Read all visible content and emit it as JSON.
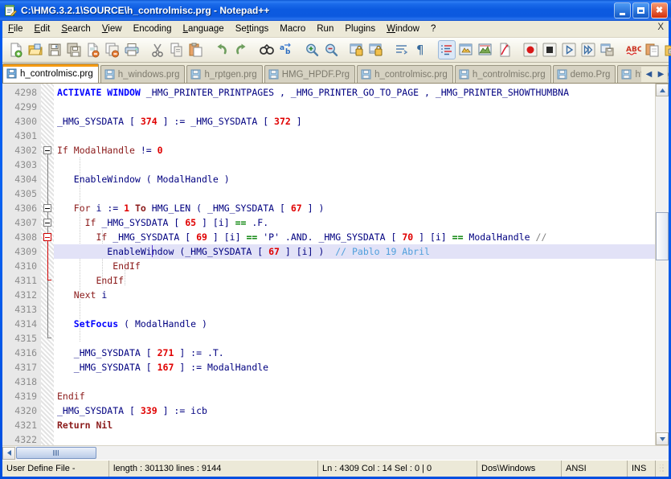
{
  "window": {
    "title": "C:\\HMG.3.2.1\\SOURCE\\h_controlmisc.prg - Notepad++",
    "icon": "notepad-document-icon",
    "buttons": {
      "minimize": "_",
      "maximize": "□",
      "close": "✕"
    }
  },
  "menubar": {
    "items": [
      {
        "label": "File",
        "mnemonic": "F"
      },
      {
        "label": "Edit",
        "mnemonic": "E"
      },
      {
        "label": "Search",
        "mnemonic": "S"
      },
      {
        "label": "View",
        "mnemonic": "V"
      },
      {
        "label": "Encoding",
        "mnemonic": ""
      },
      {
        "label": "Language",
        "mnemonic": "L"
      },
      {
        "label": "Settings",
        "mnemonic": "t"
      },
      {
        "label": "Macro",
        "mnemonic": ""
      },
      {
        "label": "Run",
        "mnemonic": ""
      },
      {
        "label": "Plugins",
        "mnemonic": ""
      },
      {
        "label": "Window",
        "mnemonic": "W"
      },
      {
        "label": "?",
        "mnemonic": ""
      }
    ],
    "close_document": "X"
  },
  "toolbar": {
    "buttons": [
      "new-file-icon",
      "open-file-icon",
      "save-icon",
      "save-all-icon",
      "close-file-icon",
      "close-all-icon",
      "print-icon",
      "cut-icon",
      "copy-icon",
      "paste-icon",
      "undo-icon",
      "redo-icon",
      "find-icon",
      "replace-icon",
      "zoom-in-icon",
      "zoom-out-icon",
      "sync-vertical-scroll-icon",
      "sync-horizontal-scroll-icon",
      "word-wrap-icon",
      "show-all-characters-icon",
      "show-indent-guide-icon",
      "user-defined-dialog-icon",
      "show-document-map-icon",
      "function-list-icon",
      "macro-record-icon",
      "macro-stop-icon",
      "macro-play-icon",
      "macro-play-multiple-icon",
      "macro-save-icon",
      "spell-check-icon",
      "copy-styled-text-icon",
      "folder-as-workspace-icon"
    ],
    "selected": "show-indent-guide-icon"
  },
  "tabs": [
    {
      "label": "h_controlmisc.prg",
      "active": true,
      "icon": "saved-file-icon"
    },
    {
      "label": "h_windows.prg",
      "active": false,
      "icon": "saved-file-icon"
    },
    {
      "label": "h_rptgen.prg",
      "active": false,
      "icon": "saved-file-icon"
    },
    {
      "label": "HMG_HPDF.Prg",
      "active": false,
      "icon": "saved-file-icon"
    },
    {
      "label": "h_controlmisc.prg",
      "active": false,
      "icon": "saved-file-icon"
    },
    {
      "label": "h_controlmisc.prg",
      "active": false,
      "icon": "saved-file-icon"
    },
    {
      "label": "demo.Prg",
      "active": false,
      "icon": "saved-file-icon"
    },
    {
      "label": "hfcl_hmg_",
      "active": false,
      "icon": "saved-file-icon"
    }
  ],
  "tab_scroll": {
    "left": "◀",
    "right": "▶"
  },
  "editor": {
    "first_line_number": 4298,
    "caret_line": 4309,
    "lines": [
      {
        "n": 4298,
        "text": "ACTIVATE WINDOW _HMG_PRINTER_PRINTPAGES , _HMG_PRINTER_GO_TO_PAGE , _HMG_PRINTER_SHOWTHUMBNA"
      },
      {
        "n": 4299,
        "text": ""
      },
      {
        "n": 4300,
        "text": "   _HMG_SYSDATA [ 374 ] := _HMG_SYSDATA [ 372 ]"
      },
      {
        "n": 4301,
        "text": ""
      },
      {
        "n": 4302,
        "text": "If ModalHandle != 0"
      },
      {
        "n": 4303,
        "text": ""
      },
      {
        "n": 4304,
        "text": "      EnableWindow ( ModalHandle )"
      },
      {
        "n": 4305,
        "text": ""
      },
      {
        "n": 4306,
        "text": "      For i := 1 To HMG_LEN ( _HMG_SYSDATA [ 67 ] )"
      },
      {
        "n": 4307,
        "text": "         If _HMG_SYSDATA [ 65 ] [i] == .F."
      },
      {
        "n": 4308,
        "text": "            If _HMG_SYSDATA [ 69 ] [i] == 'P' .AND. _HMG_SYSDATA [ 70 ] [i] == ModalHandle //"
      },
      {
        "n": 4309,
        "text": "               EnableWindow (_HMG_SYSDATA [ 67 ] [i] )  // Pablo 19 Abril"
      },
      {
        "n": 4310,
        "text": "            EndIf"
      },
      {
        "n": 4311,
        "text": "         EndIf"
      },
      {
        "n": 4312,
        "text": "      Next i"
      },
      {
        "n": 4313,
        "text": ""
      },
      {
        "n": 4314,
        "text": "      SetFocus ( ModalHandle )"
      },
      {
        "n": 4315,
        "text": ""
      },
      {
        "n": 4316,
        "text": "      _HMG_SYSDATA [ 271 ] := .T."
      },
      {
        "n": 4317,
        "text": "      _HMG_SYSDATA [ 167 ] := ModalHandle"
      },
      {
        "n": 4318,
        "text": ""
      },
      {
        "n": 4319,
        "text": "Endif"
      },
      {
        "n": 4320,
        "text": "_HMG_SYSDATA [ 339 ] := icb"
      },
      {
        "n": 4321,
        "text": "Return Nil"
      },
      {
        "n": 4322,
        "text": ""
      }
    ]
  },
  "statusbar": {
    "doc_type": "User Define File -",
    "length_lines": "length : 301130    lines : 9144",
    "position": "Ln : 4309    Col : 14    Sel : 0 | 0",
    "eol": "Dos\\Windows",
    "encoding": "ANSI",
    "insert_mode": "INS"
  },
  "colors": {
    "titlebar_blue": "#0a5ae0",
    "keyword_blue": "#0000ff",
    "identifier_maroon": "#8b1a1a",
    "number_red": "#e00000",
    "operator_navy": "#000080",
    "comment_gray": "#808080",
    "comment_blue": "#4f9fdc",
    "highlight_line": "#e2e2f7",
    "active_tab_accent": "#f59b12",
    "gutter_bg": "#e8e8e8"
  }
}
